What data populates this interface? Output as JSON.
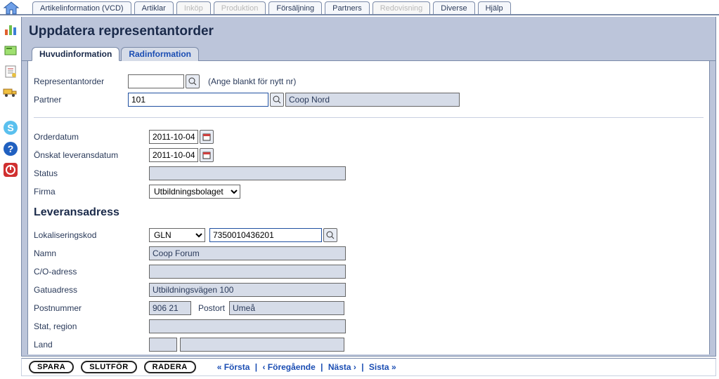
{
  "topTabs": [
    {
      "label": "Artikelinformation (VCD)",
      "disabled": false
    },
    {
      "label": "Artiklar",
      "disabled": false
    },
    {
      "label": "Inköp",
      "disabled": true
    },
    {
      "label": "Produktion",
      "disabled": true
    },
    {
      "label": "Försäljning",
      "disabled": false
    },
    {
      "label": "Partners",
      "disabled": false
    },
    {
      "label": "Redovisning",
      "disabled": true
    },
    {
      "label": "Diverse",
      "disabled": false
    },
    {
      "label": "Hjälp",
      "disabled": false
    }
  ],
  "pageTitle": "Uppdatera representantorder",
  "innerTabs": {
    "active": "Huvudinformation",
    "inactive": "Radinformation"
  },
  "section1": {
    "repOrderLabel": "Representantorder",
    "repOrderValue": "",
    "repOrderHint": "(Ange blankt för nytt nr)",
    "partnerLabel": "Partner",
    "partnerValue": "101",
    "partnerName": "Coop Nord"
  },
  "section2": {
    "orderDateLabel": "Orderdatum",
    "orderDateValue": "2011-10-04",
    "desiredDateLabel": "Önskat leveransdatum",
    "desiredDateValue": "2011-10-04",
    "statusLabel": "Status",
    "statusValue": "",
    "firmaLabel": "Firma",
    "firmaValue": "Utbildningsbolaget"
  },
  "delivery": {
    "title": "Leveransadress",
    "locCodeLabel": "Lokaliseringskod",
    "locCodeType": "GLN",
    "locCodeValue": "7350010436201",
    "nameLabel": "Namn",
    "nameValue": "Coop Forum",
    "coLabel": "C/O-adress",
    "coValue": "",
    "streetLabel": "Gatuadress",
    "streetValue": "Utbildningsvägen 100",
    "postalLabel": "Postnummer",
    "postalValue": "906 21",
    "cityLabel": "Postort",
    "cityValue": "Umeå",
    "stateLabel": "Stat, region",
    "stateValue": "",
    "countryLabel": "Land",
    "countryValue": ""
  },
  "footer": {
    "save": "SPARA",
    "finish": "SLUTFÖR",
    "delete": "RADERA",
    "first": "« Första",
    "prev": "‹ Föregående",
    "next": "Nästa ›",
    "last": "Sista »"
  }
}
